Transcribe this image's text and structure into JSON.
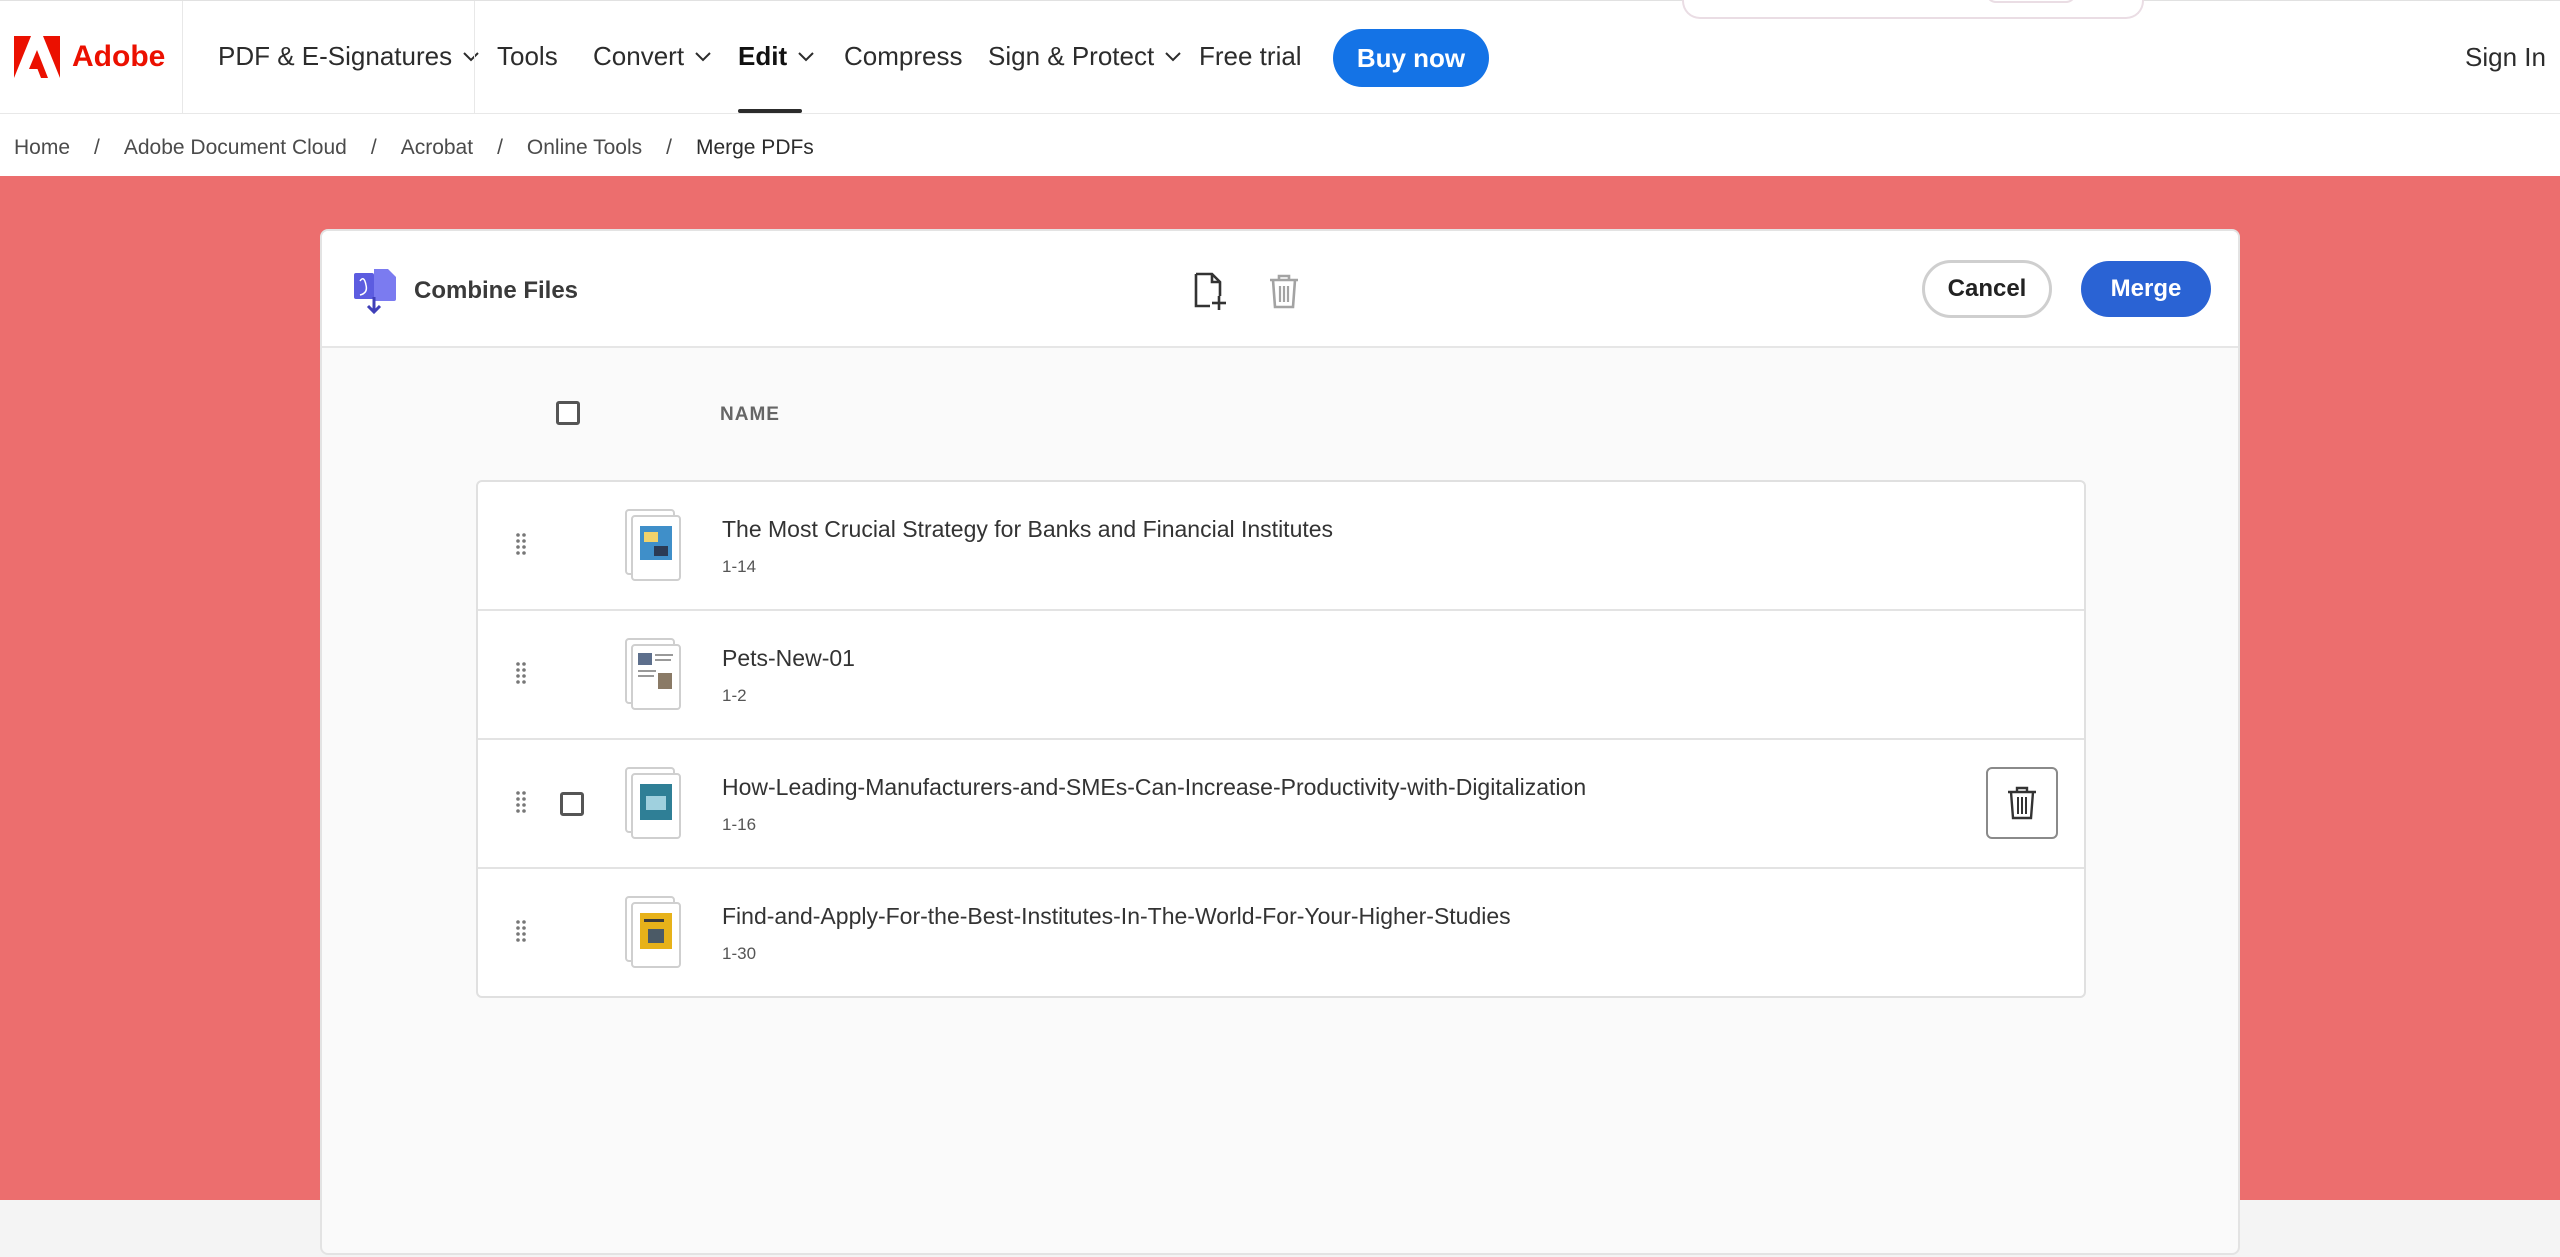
{
  "nav": {
    "brand": "Adobe",
    "items": [
      {
        "label": "PDF & E-Signatures",
        "has_menu": true
      },
      {
        "label": "Tools",
        "has_menu": false
      },
      {
        "label": "Convert",
        "has_menu": true
      },
      {
        "label": "Edit",
        "has_menu": true,
        "active": true
      },
      {
        "label": "Compress",
        "has_menu": false
      },
      {
        "label": "Sign & Protect",
        "has_menu": true
      },
      {
        "label": "Free trial",
        "has_menu": false
      }
    ],
    "buy_now": "Buy now",
    "sign_in": "Sign In"
  },
  "breadcrumb": [
    "Home",
    "Adobe Document Cloud",
    "Acrobat",
    "Online Tools",
    "Merge PDFs"
  ],
  "combine": {
    "title": "Combine Files",
    "cancel": "Cancel",
    "merge": "Merge",
    "column_name": "NAME",
    "files": [
      {
        "name": "The Most Crucial Strategy for Banks and Financial Institutes",
        "pages": "1-14",
        "thumb_color": "#3f8fc9"
      },
      {
        "name": "Pets-New-01",
        "pages": "1-2",
        "thumb_color": "#8a7a66"
      },
      {
        "name": "How-Leading-Manufacturers-and-SMEs-Can-Increase-Productivity-with-Digitalization",
        "pages": "1-16",
        "thumb_color": "#2f7f96",
        "hovered": true
      },
      {
        "name": "Find-and-Apply-For-the-Best-Institutes-In-The-World-For-Your-Higher-Studies",
        "pages": "1-30",
        "thumb_color": "#e7b21a"
      }
    ]
  },
  "colors": {
    "brand_red": "#eb1000",
    "hero_bg": "#ec6e6e",
    "primary_blue": "#1473e6",
    "merge_blue": "#2a63d4",
    "accent_purple": "#5c5ce0"
  },
  "icons": {
    "brand": "adobe-logo",
    "combine": "combine-files-icon",
    "add_file": "add-file-icon",
    "delete": "trash-icon",
    "drag": "drag-handle-icon",
    "chevron": "chevron-down-icon"
  }
}
